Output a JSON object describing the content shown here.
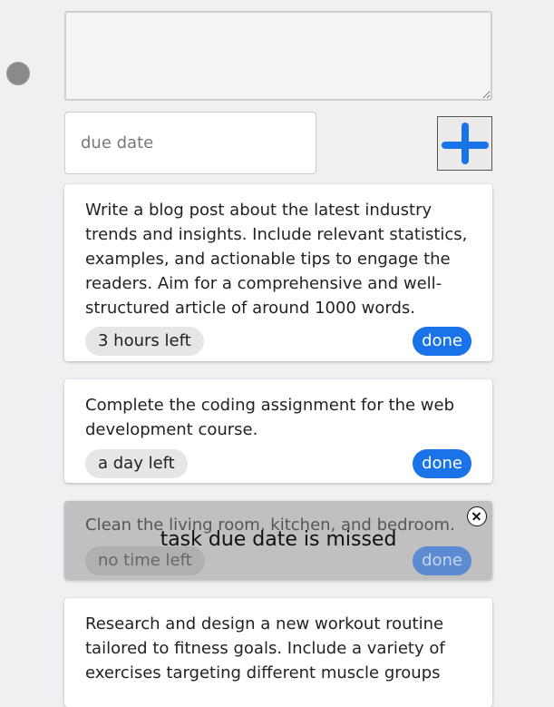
{
  "form": {
    "task_value": "",
    "due_placeholder": "due date"
  },
  "tasks": [
    {
      "text": "Write a blog post about the latest industry trends and insights. Include relevant statistics, examples, and actionable tips to engage the readers. Aim for a comprehensive and well-structured article of around 1000 words.",
      "time_left": "3 hours left",
      "done_label": "done"
    },
    {
      "text": "Complete the coding assignment for the web development course.",
      "time_left": "a day left",
      "done_label": "done"
    },
    {
      "text": "Clean the living room, kitchen, and bedroom.",
      "time_left": "no time left",
      "done_label": "done",
      "overlay_message": "task due date is missed"
    },
    {
      "text": "Research and design a new workout routine tailored to fitness goals. Include a variety of exercises targeting different muscle groups"
    }
  ],
  "colors": {
    "accent": "#1a73e8",
    "background": "#f0f0f3",
    "missed_card": "#c0c0c0"
  }
}
